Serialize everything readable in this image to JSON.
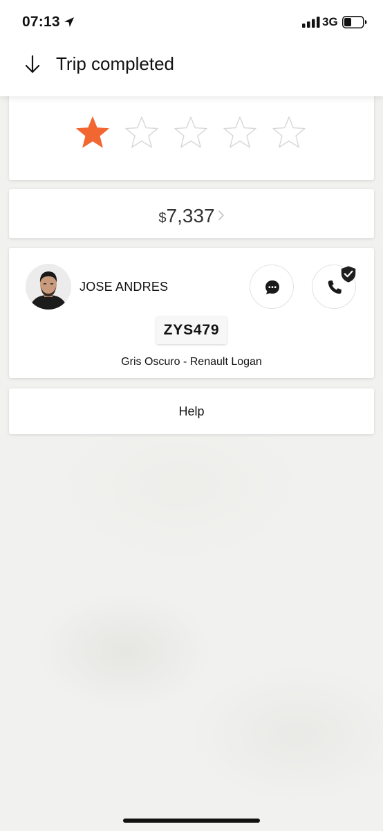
{
  "status_bar": {
    "time": "07:13",
    "network": "3G",
    "icons": [
      "location-arrow-icon",
      "signal-bars-icon",
      "battery-icon"
    ]
  },
  "header": {
    "title": "Trip completed",
    "back_icon": "arrow-down-icon"
  },
  "rating": {
    "max_stars": 5,
    "selected": 1,
    "filled_color": "#f26631",
    "empty_color": "#d7d7d7"
  },
  "fare": {
    "currency": "$",
    "amount": "7,337",
    "chevron_icon": "chevron-right-icon"
  },
  "driver": {
    "name": "JOSE ANDRES",
    "plate": "ZYS479",
    "vehicle": "Gris Oscuro - Renault Logan",
    "actions": [
      "chat-icon",
      "phone-icon"
    ],
    "badge_icon": "shield-check-icon"
  },
  "help": {
    "label": "Help"
  }
}
